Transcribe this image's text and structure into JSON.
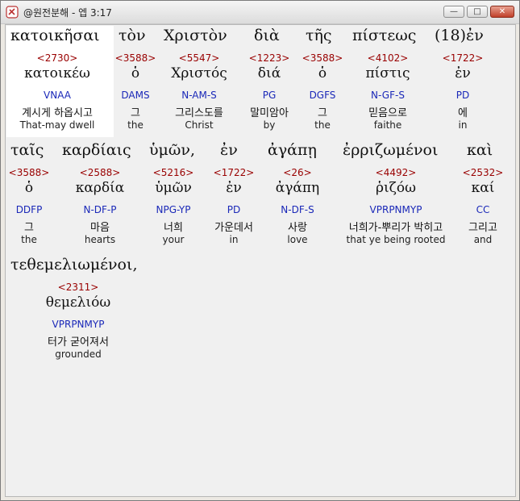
{
  "window": {
    "title": "@원전분해 - 엡 3:17",
    "minimize_label": "—",
    "maximize_label": "□",
    "close_label": "✕"
  },
  "verse_words": [
    {
      "greek": "κατοικῆσαι",
      "strong": "<2730>",
      "lemma": "κατοικέω",
      "morph": "VNAA",
      "korean": "계시게 하옵시고",
      "english": "That-may dwell",
      "highlighted": true
    },
    {
      "greek": "τὸν",
      "strong": "<3588>",
      "lemma": "ὁ",
      "morph": "DAMS",
      "korean": "그",
      "english": "the"
    },
    {
      "greek": "Χριστὸν",
      "strong": "<5547>",
      "lemma": "Χριστός",
      "morph": "N-AM-S",
      "korean": "그리스도를",
      "english": "Christ"
    },
    {
      "greek": "διὰ",
      "strong": "<1223>",
      "lemma": "διά",
      "morph": "PG",
      "korean": "말미암아",
      "english": "by"
    },
    {
      "greek": "τῆς",
      "strong": "<3588>",
      "lemma": "ὁ",
      "morph": "DGFS",
      "korean": "그",
      "english": "the"
    },
    {
      "greek": "πίστεως",
      "strong": "<4102>",
      "lemma": "πίστις",
      "morph": "N-GF-S",
      "korean": "믿음으로",
      "english": "faithe"
    },
    {
      "greek": "(18)ἐν",
      "strong": "<1722>",
      "lemma": "ἐν",
      "morph": "PD",
      "korean": "에",
      "english": "in"
    },
    {
      "greek": "ταῖς",
      "strong": "<3588>",
      "lemma": "ὁ",
      "morph": "DDFP",
      "korean": "그",
      "english": "the"
    },
    {
      "greek": "καρδίαις",
      "strong": "<2588>",
      "lemma": "καρδία",
      "morph": "N-DF-P",
      "korean": "마음",
      "english": "hearts"
    },
    {
      "greek": "ὑμῶν,",
      "strong": "<5216>",
      "lemma": "ὑμῶν",
      "morph": "NPG-YP",
      "korean": "너희",
      "english": "your"
    },
    {
      "greek": "ἐν",
      "strong": "<1722>",
      "lemma": "ἐν",
      "morph": "PD",
      "korean": "가운데서",
      "english": "in"
    },
    {
      "greek": "ἀγάπῃ",
      "strong": "<26>",
      "lemma": "ἀγάπη",
      "morph": "N-DF-S",
      "korean": "사랑",
      "english": "love"
    },
    {
      "greek": "ἐρριζωμένοι",
      "strong": "<4492>",
      "lemma": "ῥιζόω",
      "morph": "VPRPNMYP",
      "korean": "너희가-뿌리가 박히고",
      "english": "that ye being rooted"
    },
    {
      "greek": "καὶ",
      "strong": "<2532>",
      "lemma": "καί",
      "morph": "CC",
      "korean": "그리고",
      "english": "and"
    },
    {
      "greek": "τεθεμελιωμένοι,",
      "strong": "<2311>",
      "lemma": "θεμελιόω",
      "morph": "VPRPNMYP",
      "korean": "터가 굳어져서",
      "english": "grounded"
    }
  ]
}
